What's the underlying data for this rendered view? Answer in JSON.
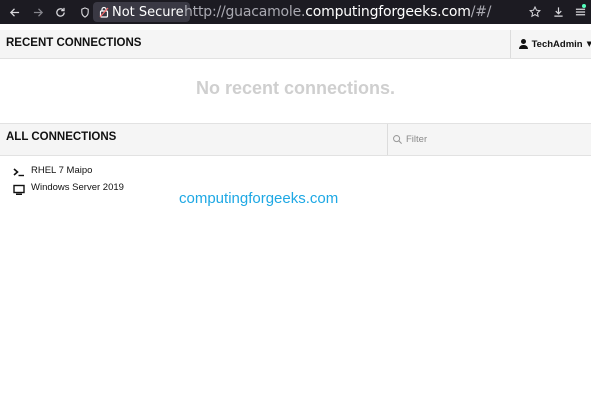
{
  "browser": {
    "back_icon": "arrow-left-icon",
    "forward_icon": "arrow-right-icon",
    "reload_icon": "reload-icon",
    "security_label": "Not Secure",
    "url_prefix": "http://guacamole.",
    "url_host": "computingforgeeks.com",
    "url_suffix": "/#/",
    "star_icon": "star-icon",
    "download_icon": "download-icon",
    "menu_icon": "hamburger-menu-icon"
  },
  "recent": {
    "title": "RECENT CONNECTIONS",
    "empty_message": "No recent connections."
  },
  "user_menu": {
    "username": "TechAdmin"
  },
  "all_connections": {
    "title": "ALL CONNECTIONS",
    "filter_placeholder": "Filter",
    "items": [
      {
        "label": "RHEL 7 Maipo",
        "icon": "terminal-icon"
      },
      {
        "label": "Windows Server 2019",
        "icon": "desktop-monitor-icon"
      }
    ]
  },
  "watermark": "computingforgeeks.com",
  "colors": {
    "chrome_bg": "#1c1b22",
    "watermark": "#1ea8e4",
    "empty_text": "#cfcfcf"
  }
}
